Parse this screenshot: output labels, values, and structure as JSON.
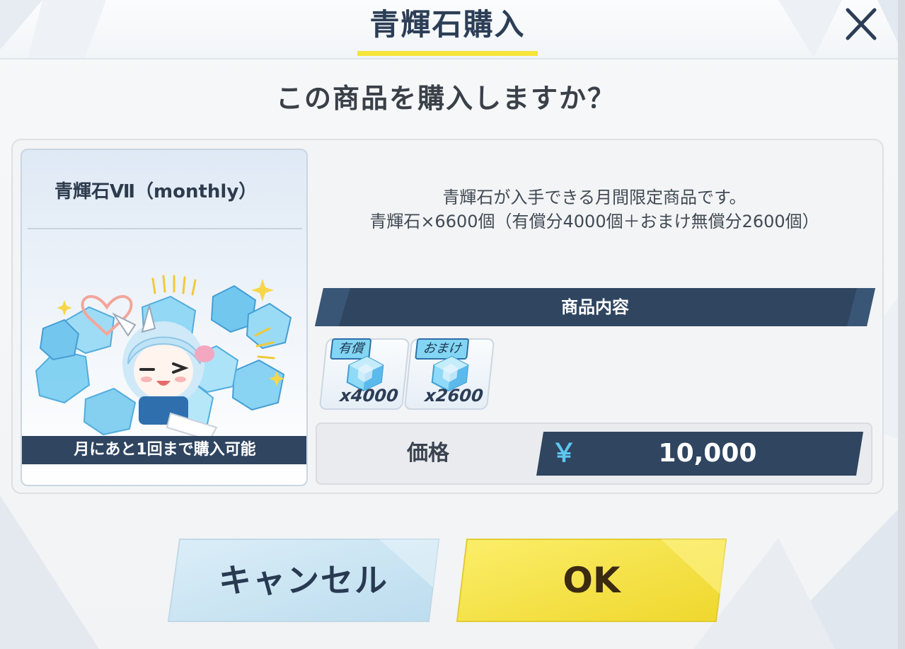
{
  "dialog": {
    "title": "青輝石購入",
    "question": "この商品を購入しますか？"
  },
  "product": {
    "name": "青輝石Ⅶ（monthly）",
    "purchase_limit": "月にあと1回まで購入可能",
    "description_line1": "青輝石が入手できる月間限定商品です。",
    "description_line2": "青輝石×6600個（有償分4000個＋おまけ無償分2600個）"
  },
  "contents": {
    "header": "商品内容",
    "items": [
      {
        "tag": "有償",
        "quantity": "x4000",
        "icon": "pyroxene-gem-icon"
      },
      {
        "tag": "おまけ",
        "quantity": "x2600",
        "icon": "pyroxene-gem-icon"
      }
    ]
  },
  "price": {
    "label": "価格",
    "currency_symbol": "￥",
    "value": "10,000"
  },
  "buttons": {
    "cancel": "キャンセル",
    "ok": "OK"
  },
  "colors": {
    "title_underline": "#f5e43a",
    "navy_bar": "#2f4560",
    "ok_yellow": "#f4e23c",
    "cancel_blue": "#cfe6f3",
    "yen_cyan": "#5ec8f0"
  }
}
